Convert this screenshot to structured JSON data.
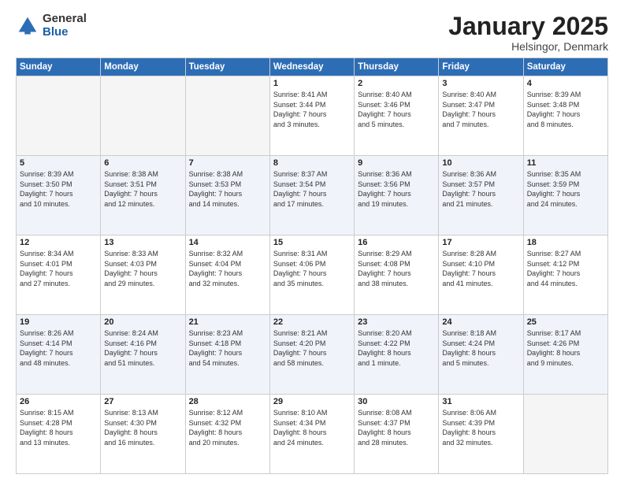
{
  "logo": {
    "general": "General",
    "blue": "Blue"
  },
  "header": {
    "month": "January 2025",
    "location": "Helsingor, Denmark"
  },
  "weekdays": [
    "Sunday",
    "Monday",
    "Tuesday",
    "Wednesday",
    "Thursday",
    "Friday",
    "Saturday"
  ],
  "weeks": [
    [
      {
        "day": "",
        "info": ""
      },
      {
        "day": "",
        "info": ""
      },
      {
        "day": "",
        "info": ""
      },
      {
        "day": "1",
        "info": "Sunrise: 8:41 AM\nSunset: 3:44 PM\nDaylight: 7 hours\nand 3 minutes."
      },
      {
        "day": "2",
        "info": "Sunrise: 8:40 AM\nSunset: 3:46 PM\nDaylight: 7 hours\nand 5 minutes."
      },
      {
        "day": "3",
        "info": "Sunrise: 8:40 AM\nSunset: 3:47 PM\nDaylight: 7 hours\nand 7 minutes."
      },
      {
        "day": "4",
        "info": "Sunrise: 8:39 AM\nSunset: 3:48 PM\nDaylight: 7 hours\nand 8 minutes."
      }
    ],
    [
      {
        "day": "5",
        "info": "Sunrise: 8:39 AM\nSunset: 3:50 PM\nDaylight: 7 hours\nand 10 minutes."
      },
      {
        "day": "6",
        "info": "Sunrise: 8:38 AM\nSunset: 3:51 PM\nDaylight: 7 hours\nand 12 minutes."
      },
      {
        "day": "7",
        "info": "Sunrise: 8:38 AM\nSunset: 3:53 PM\nDaylight: 7 hours\nand 14 minutes."
      },
      {
        "day": "8",
        "info": "Sunrise: 8:37 AM\nSunset: 3:54 PM\nDaylight: 7 hours\nand 17 minutes."
      },
      {
        "day": "9",
        "info": "Sunrise: 8:36 AM\nSunset: 3:56 PM\nDaylight: 7 hours\nand 19 minutes."
      },
      {
        "day": "10",
        "info": "Sunrise: 8:36 AM\nSunset: 3:57 PM\nDaylight: 7 hours\nand 21 minutes."
      },
      {
        "day": "11",
        "info": "Sunrise: 8:35 AM\nSunset: 3:59 PM\nDaylight: 7 hours\nand 24 minutes."
      }
    ],
    [
      {
        "day": "12",
        "info": "Sunrise: 8:34 AM\nSunset: 4:01 PM\nDaylight: 7 hours\nand 27 minutes."
      },
      {
        "day": "13",
        "info": "Sunrise: 8:33 AM\nSunset: 4:03 PM\nDaylight: 7 hours\nand 29 minutes."
      },
      {
        "day": "14",
        "info": "Sunrise: 8:32 AM\nSunset: 4:04 PM\nDaylight: 7 hours\nand 32 minutes."
      },
      {
        "day": "15",
        "info": "Sunrise: 8:31 AM\nSunset: 4:06 PM\nDaylight: 7 hours\nand 35 minutes."
      },
      {
        "day": "16",
        "info": "Sunrise: 8:29 AM\nSunset: 4:08 PM\nDaylight: 7 hours\nand 38 minutes."
      },
      {
        "day": "17",
        "info": "Sunrise: 8:28 AM\nSunset: 4:10 PM\nDaylight: 7 hours\nand 41 minutes."
      },
      {
        "day": "18",
        "info": "Sunrise: 8:27 AM\nSunset: 4:12 PM\nDaylight: 7 hours\nand 44 minutes."
      }
    ],
    [
      {
        "day": "19",
        "info": "Sunrise: 8:26 AM\nSunset: 4:14 PM\nDaylight: 7 hours\nand 48 minutes."
      },
      {
        "day": "20",
        "info": "Sunrise: 8:24 AM\nSunset: 4:16 PM\nDaylight: 7 hours\nand 51 minutes."
      },
      {
        "day": "21",
        "info": "Sunrise: 8:23 AM\nSunset: 4:18 PM\nDaylight: 7 hours\nand 54 minutes."
      },
      {
        "day": "22",
        "info": "Sunrise: 8:21 AM\nSunset: 4:20 PM\nDaylight: 7 hours\nand 58 minutes."
      },
      {
        "day": "23",
        "info": "Sunrise: 8:20 AM\nSunset: 4:22 PM\nDaylight: 8 hours\nand 1 minute."
      },
      {
        "day": "24",
        "info": "Sunrise: 8:18 AM\nSunset: 4:24 PM\nDaylight: 8 hours\nand 5 minutes."
      },
      {
        "day": "25",
        "info": "Sunrise: 8:17 AM\nSunset: 4:26 PM\nDaylight: 8 hours\nand 9 minutes."
      }
    ],
    [
      {
        "day": "26",
        "info": "Sunrise: 8:15 AM\nSunset: 4:28 PM\nDaylight: 8 hours\nand 13 minutes."
      },
      {
        "day": "27",
        "info": "Sunrise: 8:13 AM\nSunset: 4:30 PM\nDaylight: 8 hours\nand 16 minutes."
      },
      {
        "day": "28",
        "info": "Sunrise: 8:12 AM\nSunset: 4:32 PM\nDaylight: 8 hours\nand 20 minutes."
      },
      {
        "day": "29",
        "info": "Sunrise: 8:10 AM\nSunset: 4:34 PM\nDaylight: 8 hours\nand 24 minutes."
      },
      {
        "day": "30",
        "info": "Sunrise: 8:08 AM\nSunset: 4:37 PM\nDaylight: 8 hours\nand 28 minutes."
      },
      {
        "day": "31",
        "info": "Sunrise: 8:06 AM\nSunset: 4:39 PM\nDaylight: 8 hours\nand 32 minutes."
      },
      {
        "day": "",
        "info": ""
      }
    ]
  ]
}
